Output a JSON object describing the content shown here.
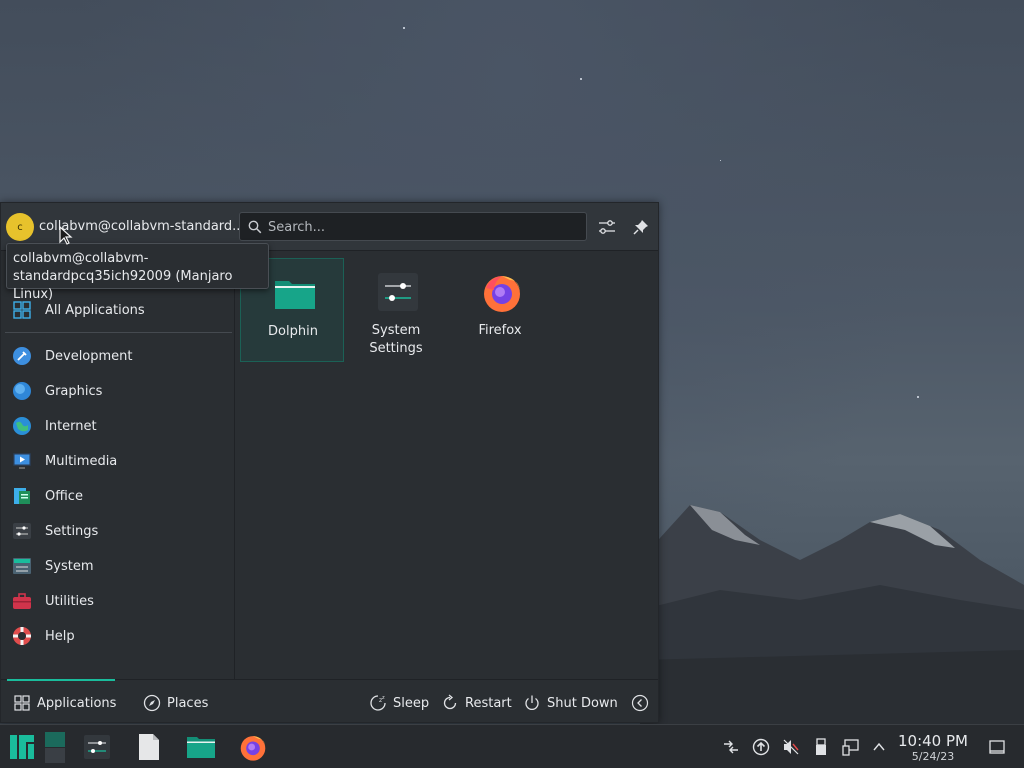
{
  "user": {
    "avatar_letter": "c",
    "name": "collabvm@collabvm-standard...",
    "tooltip": "collabvm@collabvm-standardpcq35ich92009 (Manjaro Linux)"
  },
  "search": {
    "placeholder": "Search..."
  },
  "categories": [
    {
      "label": "All Applications",
      "icon": "grid-icon"
    },
    {
      "label": "Development",
      "icon": "development-icon"
    },
    {
      "label": "Graphics",
      "icon": "graphics-icon"
    },
    {
      "label": "Internet",
      "icon": "internet-icon"
    },
    {
      "label": "Multimedia",
      "icon": "multimedia-icon"
    },
    {
      "label": "Office",
      "icon": "office-icon"
    },
    {
      "label": "Settings",
      "icon": "settings-icon"
    },
    {
      "label": "System",
      "icon": "system-icon"
    },
    {
      "label": "Utilities",
      "icon": "utilities-icon"
    },
    {
      "label": "Help",
      "icon": "help-icon"
    }
  ],
  "favorites": [
    {
      "label": "Dolphin",
      "icon": "folder-icon"
    },
    {
      "label": "System Settings",
      "icon": "system-settings-icon"
    },
    {
      "label": "Firefox",
      "icon": "firefox-icon"
    }
  ],
  "footer": {
    "applications": "Applications",
    "places": "Places",
    "sleep": "Sleep",
    "restart": "Restart",
    "shutdown": "Shut Down"
  },
  "taskbar": {
    "time": "10:40 PM",
    "date": "5/24/23"
  },
  "colors": {
    "accent": "#1abc9c",
    "panel": "#2a2e32",
    "taskbar": "#272a2e"
  }
}
